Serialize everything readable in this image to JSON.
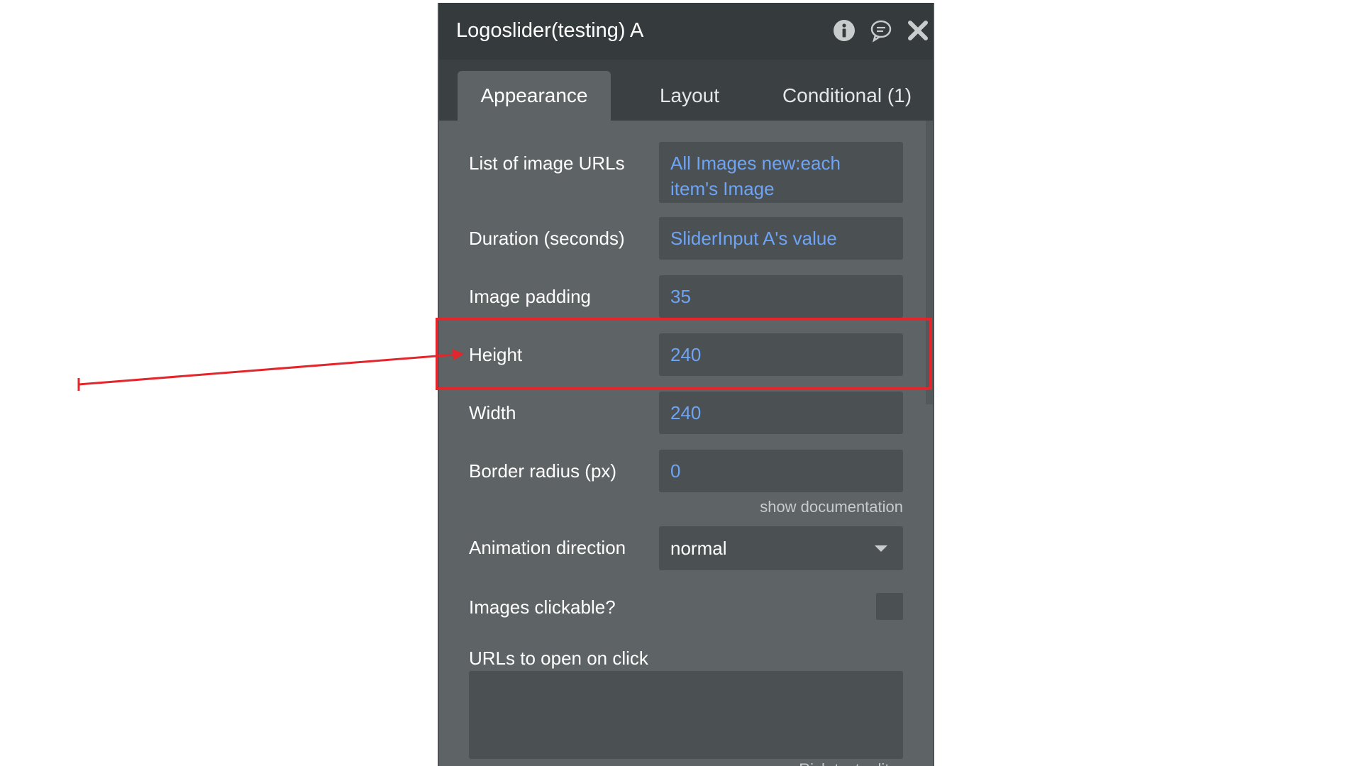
{
  "panel": {
    "title": "Logoslider(testing) A",
    "icons": {
      "info": "info-icon",
      "comment": "comment-icon",
      "close": "close-icon"
    }
  },
  "tabs": [
    {
      "label": "Appearance",
      "active": true
    },
    {
      "label": "Layout",
      "active": false
    },
    {
      "label": "Conditional (1)",
      "active": false
    }
  ],
  "fields": {
    "image_urls": {
      "label": "List of image URLs",
      "value": "All Images new:each item's Image"
    },
    "duration": {
      "label": "Duration (seconds)",
      "value": "SliderInput A's value"
    },
    "image_padding": {
      "label": "Image padding",
      "value": "35"
    },
    "height": {
      "label": "Height",
      "value": "240"
    },
    "width": {
      "label": "Width",
      "value": "240"
    },
    "border_radius": {
      "label": "Border radius (px)",
      "value": "0"
    },
    "show_documentation": "show documentation",
    "animation_direction": {
      "label": "Animation direction",
      "value": "normal"
    },
    "images_clickable": {
      "label": "Images clickable?",
      "checked": false
    },
    "urls_on_click": {
      "label": "URLs to open on click",
      "value": ""
    },
    "rich_text_editor": "Rich text editor"
  },
  "colors": {
    "panel_bg": "#5e6366",
    "header_bg": "#353a3d",
    "field_bg": "#4b5053",
    "value_text": "#6fa4f4",
    "highlight": "#e3262b"
  }
}
